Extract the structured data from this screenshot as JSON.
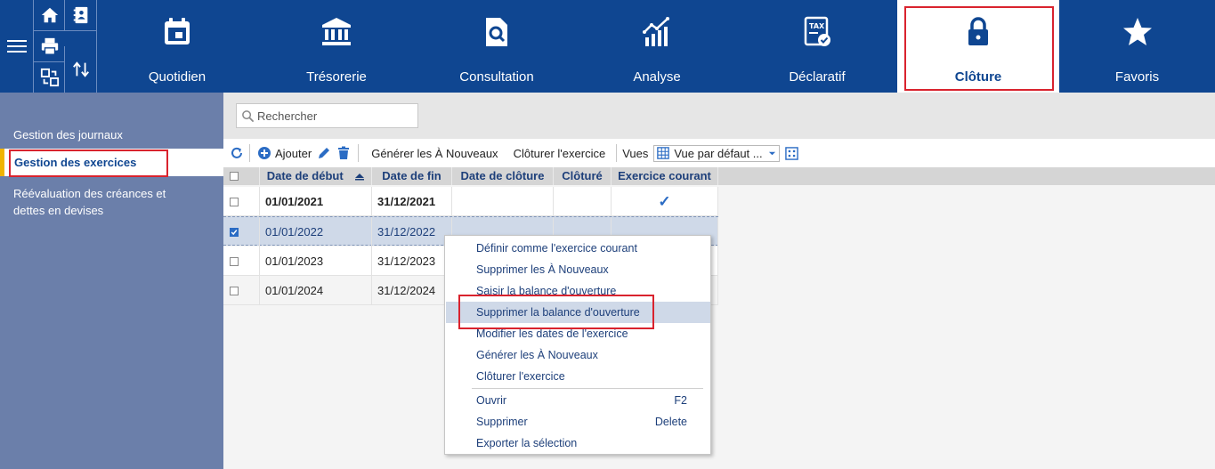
{
  "topbar": {
    "tabs": [
      {
        "label": "Quotidien",
        "icon": "calendar-icon"
      },
      {
        "label": "Trésorerie",
        "icon": "bank-icon"
      },
      {
        "label": "Consultation",
        "icon": "search-document-icon"
      },
      {
        "label": "Analyse",
        "icon": "chart-icon"
      },
      {
        "label": "Déclaratif",
        "icon": "tax-icon"
      },
      {
        "label": "Clôture",
        "icon": "lock-icon"
      },
      {
        "label": "Favoris",
        "icon": "star-icon"
      }
    ],
    "active_tab": "Clôture",
    "quick_icons": [
      "home-icon",
      "contacts-icon",
      "print-icon",
      "transfer-icon",
      "sort-icon"
    ]
  },
  "sidebar": {
    "items": [
      {
        "label": "Gestion des journaux"
      },
      {
        "label": "Gestion des exercices"
      },
      {
        "label": "Réévaluation des créances et dettes en devises"
      }
    ],
    "active_item": "Gestion des exercices"
  },
  "search": {
    "placeholder": "Rechercher"
  },
  "toolbar": {
    "add_label": "Ajouter",
    "generate_label": "Générer les À Nouveaux",
    "close_label": "Clôturer l'exercice",
    "views_label": "Vues",
    "view_value": "Vue par défaut ..."
  },
  "grid": {
    "columns": [
      "Date de début",
      "Date de fin",
      "Date de clôture",
      "Clôturé",
      "Exercice courant"
    ],
    "rows": [
      {
        "start": "01/01/2021",
        "end": "31/12/2021",
        "closing": "",
        "closed": "",
        "current": "✓"
      },
      {
        "start": "01/01/2022",
        "end": "31/12/2022",
        "closing": "",
        "closed": "",
        "current": ""
      },
      {
        "start": "01/01/2023",
        "end": "31/12/2023",
        "closing": "",
        "closed": "",
        "current": ""
      },
      {
        "start": "01/01/2024",
        "end": "31/12/2024",
        "closing": "",
        "closed": "",
        "current": ""
      }
    ]
  },
  "context_menu": {
    "items": [
      {
        "label": "Définir comme l'exercice courant",
        "shortcut": ""
      },
      {
        "label": "Supprimer les À Nouveaux",
        "shortcut": ""
      },
      {
        "label": "Saisir la balance d'ouverture",
        "shortcut": ""
      },
      {
        "label": "Supprimer la balance d'ouverture",
        "shortcut": ""
      },
      {
        "label": "Modifier les dates de l'exercice",
        "shortcut": ""
      },
      {
        "label": "Générer les À Nouveaux",
        "shortcut": ""
      },
      {
        "label": "Clôturer l'exercice",
        "shortcut": ""
      },
      {
        "label": "Ouvrir",
        "shortcut": "F2"
      },
      {
        "label": "Supprimer",
        "shortcut": "Delete"
      },
      {
        "label": "Exporter la sélection",
        "shortcut": ""
      }
    ]
  },
  "colors": {
    "brand": "#0f4691",
    "sidebar": "#6b7faa",
    "highlight": "#d9232e",
    "accent": "#f0b400"
  }
}
